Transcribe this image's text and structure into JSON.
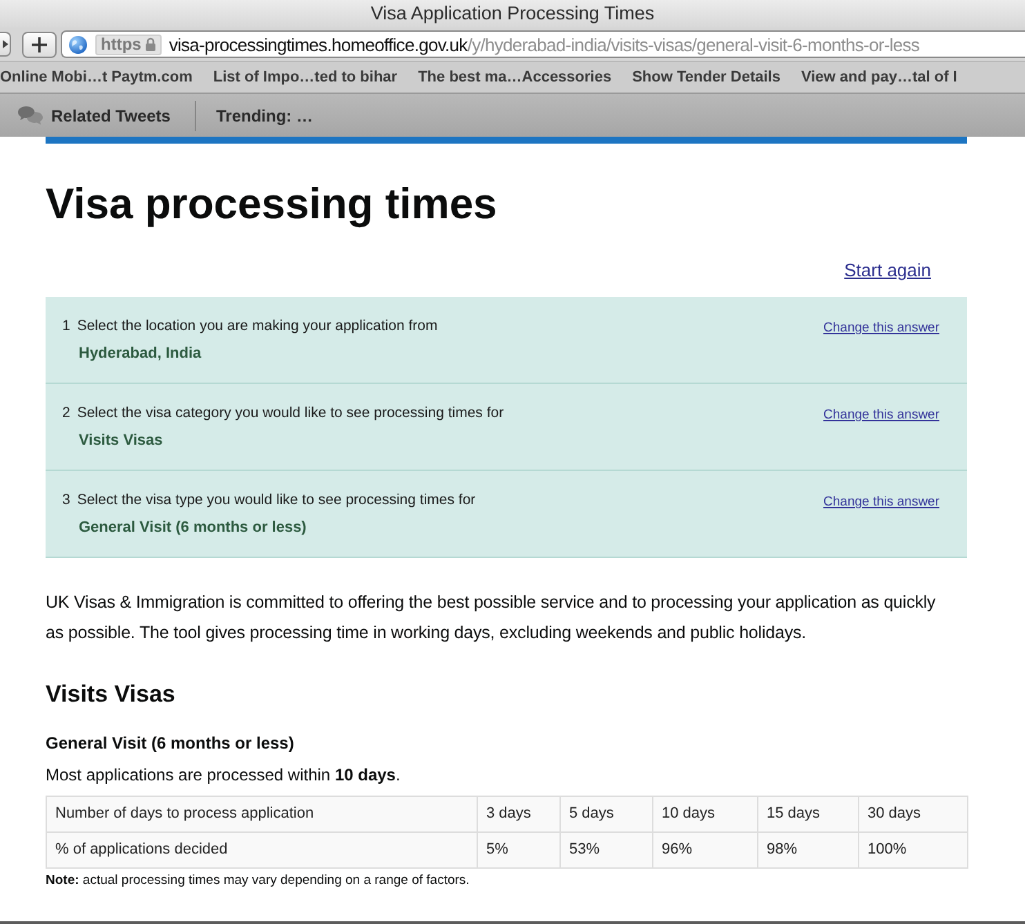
{
  "window": {
    "title": "Visa Application Processing Times"
  },
  "toolbar": {
    "scheme": "https",
    "url_host": "visa-processingtimes.homeoffice.gov.uk",
    "url_path": "/y/hyderabad-india/visits-visas/general-visit-6-months-or-less"
  },
  "bookmarks": [
    "Online Mobi…t Paytm.com",
    "List of Impo…ted to bihar",
    "The best ma…Accessories",
    "Show Tender Details",
    "View and pay…tal of I"
  ],
  "tweets_bar": {
    "label": "Related Tweets",
    "trending": "Trending: …"
  },
  "page": {
    "title": "Visa processing times",
    "start_again": "Start again",
    "answers": [
      {
        "number": "1",
        "question": "Select the location you are making your application from",
        "answer": "Hyderabad, India",
        "change": "Change this answer"
      },
      {
        "number": "2",
        "question": "Select the visa category you would like to see processing times for",
        "answer": "Visits Visas",
        "change": "Change this answer"
      },
      {
        "number": "3",
        "question": "Select the visa type you would like to see processing times for",
        "answer": "General Visit (6 months or less)",
        "change": "Change this answer"
      }
    ],
    "intro": "UK Visas & Immigration is committed to offering the best possible service and to processing your application as quickly as possible. The tool gives processing time in working days, excluding weekends and public holidays.",
    "section_title": "Visits Visas",
    "visa_type": "General Visit (6 months or less)",
    "summary": "Most applications are processed within **10 days**.",
    "table": {
      "rows": [
        [
          "Number of days to process application",
          "3 days",
          "5 days",
          "10 days",
          "15 days",
          "30 days"
        ],
        [
          "% of applications decided",
          "5%",
          "53%",
          "96%",
          "98%",
          "100%"
        ]
      ]
    },
    "note": "**Note:** actual processing times may vary depending on a range of factors."
  }
}
